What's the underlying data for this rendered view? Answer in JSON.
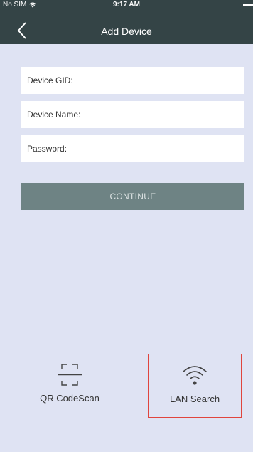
{
  "status_bar": {
    "carrier": "No SIM",
    "time": "9:17 AM"
  },
  "nav": {
    "title": "Add Device",
    "back_icon": "chevron-left-icon"
  },
  "form": {
    "fields": [
      {
        "label": "Device GID:",
        "value": ""
      },
      {
        "label": "Device Name:",
        "value": ""
      },
      {
        "label": "Password:",
        "value": ""
      }
    ],
    "continue_label": "CONTINUE"
  },
  "actions": [
    {
      "label": "QR CodeScan",
      "icon": "qr-scan-icon",
      "highlighted": false
    },
    {
      "label": "LAN Search",
      "icon": "wifi-icon",
      "highlighted": true
    }
  ],
  "colors": {
    "header": "#344446",
    "background": "#dfe3f3",
    "button": "#6e8384",
    "highlight": "#e0453d"
  }
}
